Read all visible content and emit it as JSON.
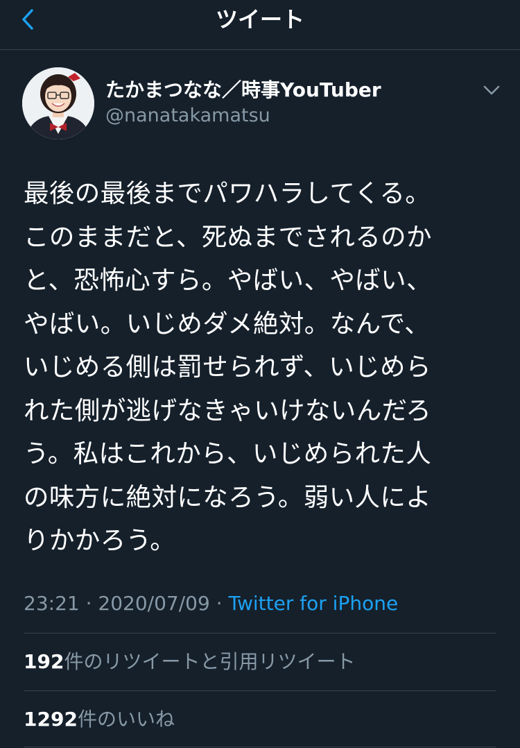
{
  "header": {
    "title": "ツイート",
    "back_icon": "chevron-left-icon",
    "accent_color": "#1da1f2"
  },
  "author": {
    "display_name": "たかまつなな／時事YouTuber",
    "handle": "@nanatakamatsu",
    "menu_icon": "chevron-down-icon"
  },
  "tweet": {
    "lines": [
      "最後の最後までパワハラしてくる。",
      "このままだと、死ぬまでされるのか",
      "と、恐怖心すら。やばい、やばい、",
      "やばい。いじめダメ絶対。なんで、",
      "いじめる側は罰せられず、いじめら",
      "れた側が逃げなきゃいけないんだろ",
      "う。私はこれから、いじめられた人",
      "の味方に絶対になろう。弱い人によ",
      "りかかろう。"
    ],
    "time": "23:21",
    "separator": "·",
    "date": "2020/07/09",
    "source": "Twitter for iPhone"
  },
  "stats": {
    "retweets_count": "192",
    "retweets_label": "件のリツイートと引用リツイート",
    "likes_count": "1292",
    "likes_label": "件のいいね"
  }
}
